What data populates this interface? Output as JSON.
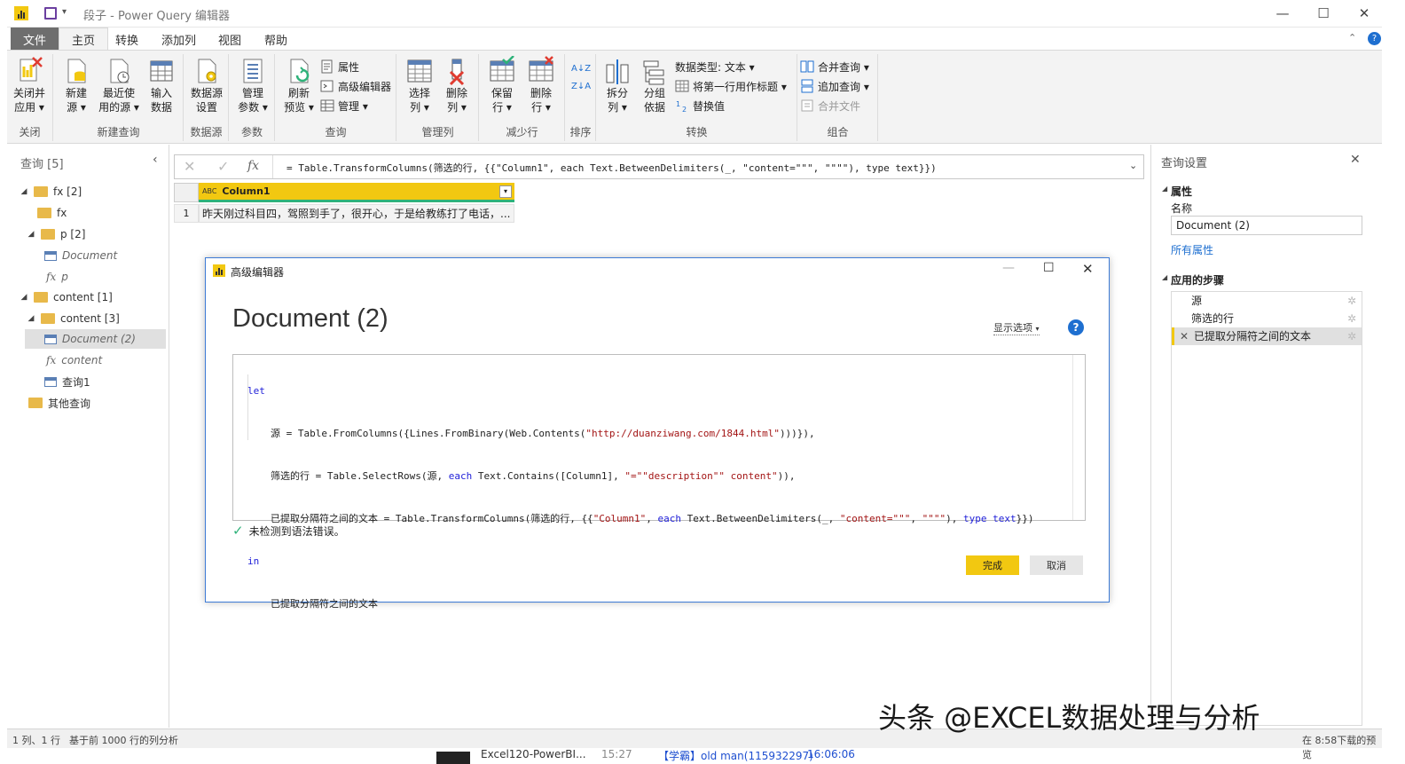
{
  "window": {
    "title": "段子 - Power Query 编辑器",
    "controls": {
      "minimize": "—",
      "maximize": "☐",
      "close": "✕"
    }
  },
  "menu_tabs": [
    {
      "label": "文件"
    },
    {
      "label": "主页"
    },
    {
      "label": "转换"
    },
    {
      "label": "添加列"
    },
    {
      "label": "视图"
    },
    {
      "label": "帮助"
    }
  ],
  "ribbon": {
    "groups": {
      "close": "关闭",
      "new_query": "新建查询",
      "data_source": "数据源",
      "params": "参数",
      "query": "查询",
      "manage_cols": "管理列",
      "reduce_rows": "减少行",
      "sort": "排序",
      "transform": "转换",
      "combine": "组合"
    },
    "buttons": {
      "close_apply": [
        "关闭并",
        "应用 ▾"
      ],
      "new_source": [
        "新建",
        "源 ▾"
      ],
      "recent_sources": [
        "最近使",
        "用的源 ▾"
      ],
      "enter_data": [
        "输入",
        "数据"
      ],
      "data_source_settings": [
        "数据源",
        "设置"
      ],
      "manage_params": [
        "管理",
        "参数 ▾"
      ],
      "refresh_preview": [
        "刷新",
        "预览 ▾"
      ],
      "properties": "属性",
      "advanced_editor": "高级编辑器",
      "manage": "管理 ▾",
      "choose_columns": [
        "选择",
        "列 ▾"
      ],
      "remove_columns": [
        "删除",
        "列 ▾"
      ],
      "keep_rows": [
        "保留",
        "行 ▾"
      ],
      "remove_rows": [
        "删除",
        "行 ▾"
      ],
      "split_column": [
        "拆分",
        "列 ▾"
      ],
      "group_by": [
        "分组",
        "依据"
      ],
      "data_type": "数据类型: 文本 ▾",
      "first_row_header": "将第一行用作标题 ▾",
      "replace_values": "替换值",
      "merge_queries": "合并查询 ▾",
      "append_queries": "追加查询 ▾",
      "combine_files": "合并文件"
    }
  },
  "queries_panel": {
    "title": "查询 [5]",
    "tree": [
      {
        "label": "fx [2]",
        "kind": "folder"
      },
      {
        "label": "fx",
        "kind": "folder"
      },
      {
        "label": "p [2]",
        "kind": "folder"
      },
      {
        "label": "Document",
        "kind": "table"
      },
      {
        "label": "p",
        "kind": "function"
      },
      {
        "label": "content [1]",
        "kind": "folder"
      },
      {
        "label": "content [3]",
        "kind": "folder"
      },
      {
        "label": "Document (2)",
        "kind": "table"
      },
      {
        "label": "content",
        "kind": "function"
      },
      {
        "label": "查询1",
        "kind": "table"
      },
      {
        "label": "其他查询",
        "kind": "folder"
      }
    ]
  },
  "formula_bar": {
    "fx": "fx",
    "formula": "= Table.TransformColumns(筛选的行, {{\"Column1\", each Text.BetweenDelimiters(_, \"content=\"\"\", \"\"\"\"), type text}})"
  },
  "grid": {
    "column_header": "Column1",
    "type_icon": "ABC",
    "rows": [
      {
        "num": "1",
        "value": "昨天刚过科目四，驾照到手了，很开心，于是给教练打了电话，..."
      }
    ]
  },
  "settings_panel": {
    "title": "查询设置",
    "properties_header": "属性",
    "name_label": "名称",
    "name_value": "Document (2)",
    "all_properties": "所有属性",
    "steps_header": "应用的步骤",
    "steps": [
      {
        "label": "源"
      },
      {
        "label": "筛选的行"
      },
      {
        "label": "已提取分隔符之间的文本"
      }
    ]
  },
  "status_bar": {
    "left1": "1 列、1 行",
    "left2": "基于前 1000 行的列分析",
    "right": "在 8:58下载的预览"
  },
  "advanced_editor": {
    "window_title": "高级编辑器",
    "doc_title": "Document (2)",
    "display_options": "显示选项",
    "help": "?",
    "code": {
      "let": "let",
      "line1_name": "源 = ",
      "line1_code": "Table.FromColumns({Lines.FromBinary(Web.Contents(",
      "line1_str": "\"http://duanziwang.com/1844.html\"",
      "line1_end": ")))}),",
      "line2_name": "筛选的行 = ",
      "line2_code": "Table.SelectRows(源, ",
      "line2_kw": "each",
      "line2_code2": " Text.Contains([Column1], ",
      "line2_str": "\"=\"\"description\"\" content\"",
      "line2_end": ")),",
      "line3_name": "已提取分隔符之间的文本 = ",
      "line3_code": "Table.TransformColumns(筛选的行, {{",
      "line3_str1": "\"Column1\"",
      "line3_sep": ", ",
      "line3_kw": "each",
      "line3_code2": " Text.BetweenDelimiters(_, ",
      "line3_str2": "\"content=\"\"\"",
      "line3_sep2": ", ",
      "line3_str3": "\"\"\"\"",
      "line3_code3": "), ",
      "line3_kw2": "type",
      "line3_sp": " ",
      "line3_kw3": "text",
      "line3_end": "}})",
      "in": "in",
      "result": "已提取分隔符之间的文本"
    },
    "status": "未检测到语法错误。",
    "done": "完成",
    "cancel": "取消"
  },
  "watermark": "头条 @EXCEL数据处理与分析",
  "taskbar_peek": {
    "left": "Excel120-PowerBI...",
    "time1": "15:27",
    "mid": "【学霸】old man(115932297)",
    "time2": "16:06:06"
  },
  "colors": {
    "accent_yellow": "#f2c811",
    "green": "#2fb27a",
    "dialog_border": "#3d7bd6",
    "keyword_blue": "#1f1fd8",
    "string_red": "#a31515"
  }
}
